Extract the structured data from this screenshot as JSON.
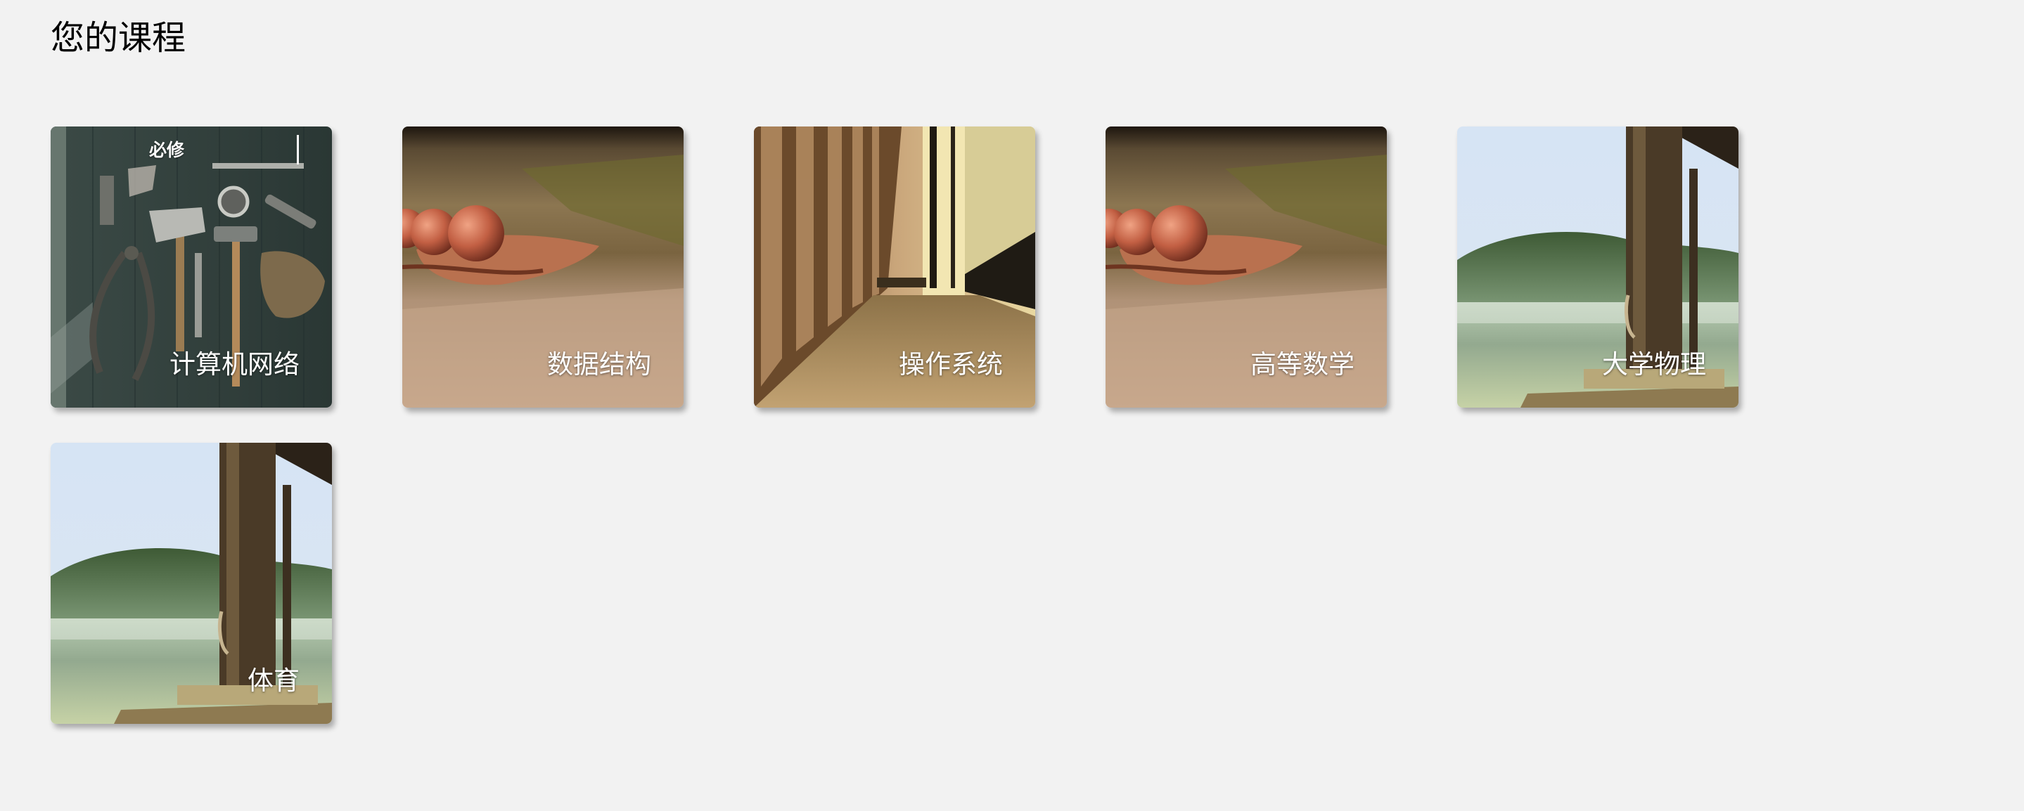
{
  "page": {
    "title": "您的课程"
  },
  "courses": [
    {
      "name": "计算机网络",
      "badge": "必修",
      "image": "tools-on-wood-image"
    },
    {
      "name": "数据结构",
      "badge": "",
      "image": "baseballs-on-glove-image"
    },
    {
      "name": "操作系统",
      "badge": "",
      "image": "hallway-lockers-image"
    },
    {
      "name": "高等数学",
      "badge": "",
      "image": "baseballs-on-glove-image"
    },
    {
      "name": "大学物理",
      "badge": "",
      "image": "lake-dock-image"
    },
    {
      "name": "体育",
      "badge": "",
      "image": "lake-dock-image"
    }
  ]
}
